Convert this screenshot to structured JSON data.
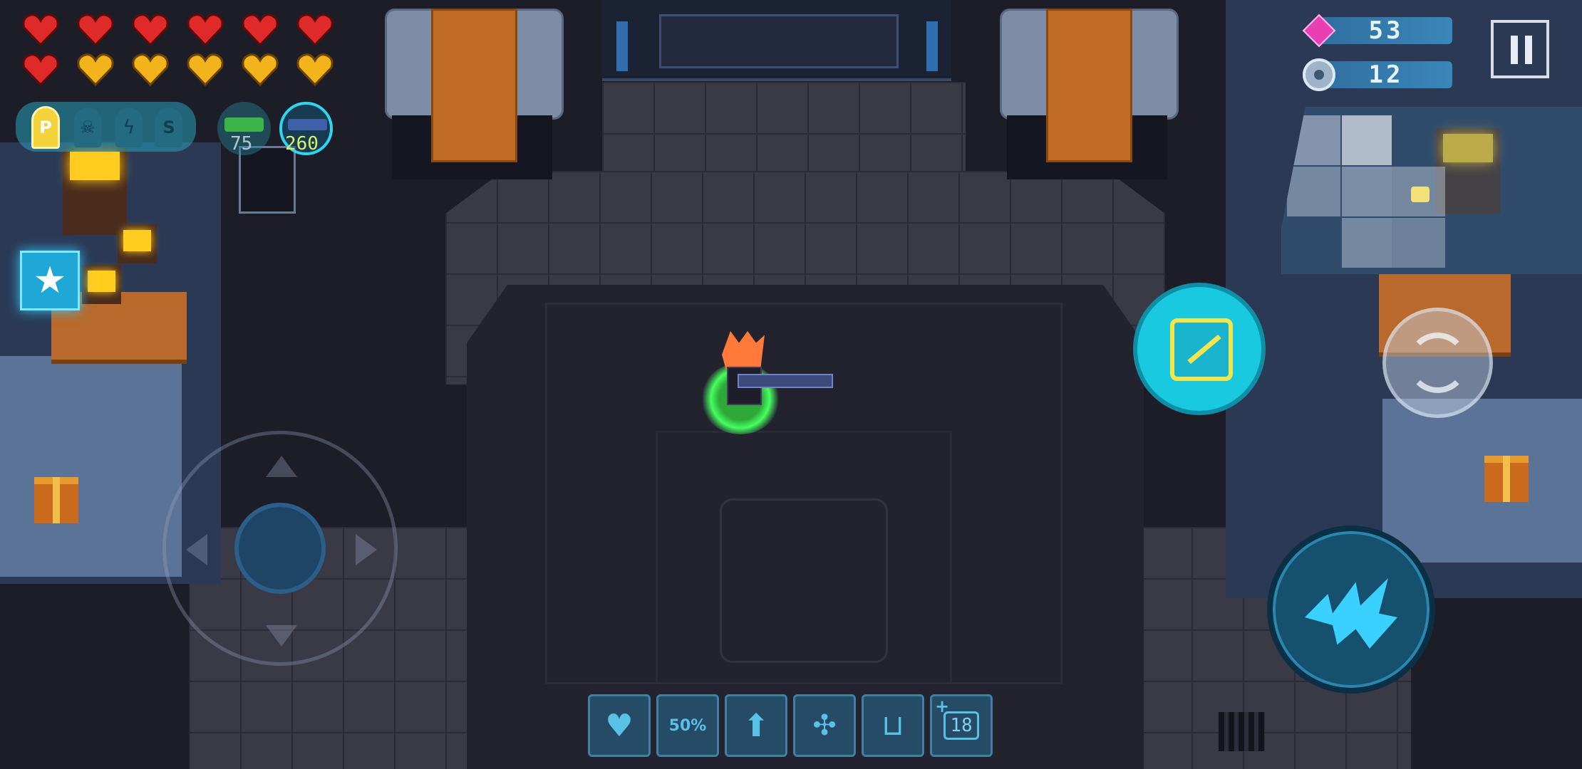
{
  "hud": {
    "health_hearts": {
      "red": 7,
      "gold": 5
    },
    "buff_slots": [
      {
        "label": "P",
        "icon": "bullet-p-icon",
        "active": true
      },
      {
        "label": "",
        "icon": "skull-icon",
        "active": false
      },
      {
        "label": "",
        "icon": "lightning-icon",
        "active": false
      },
      {
        "label": "S",
        "icon": "s-slot-icon",
        "active": false
      }
    ],
    "weapons": [
      {
        "icon": "green-gun-icon",
        "ammo": "75",
        "selected": false
      },
      {
        "icon": "sniper-rifle-icon",
        "ammo": "260",
        "selected": true
      }
    ],
    "gems": "53",
    "cores": "12",
    "pause_icon": "pause-icon",
    "star_icon": "star-badge-icon"
  },
  "controls": {
    "joystick": "virtual-joystick",
    "skill_button_icon": "dash-skill-icon",
    "swap_weapon_icon": "swap-weapon-icon",
    "attack_button_icon": "claw-attack-icon"
  },
  "skill_bar": [
    {
      "icon": "heart-burst-icon",
      "label": ""
    },
    {
      "icon": "percent-bag-icon",
      "label": "50%"
    },
    {
      "icon": "arrow-up-icon",
      "label": ""
    },
    {
      "icon": "network-icon",
      "label": ""
    },
    {
      "icon": "magnet-icon",
      "label": ""
    },
    {
      "icon": "chest-count-icon",
      "label": "18",
      "prefix": "+"
    }
  ],
  "colors": {
    "accent_cyan": "#19c9e0",
    "heart_red": "#e02a2a",
    "heart_gold": "#f2b31b",
    "gem_pink": "#e83fb2",
    "floor_light": "#3a3a47",
    "floor_dark": "#232330",
    "player_glow": "#33e04a"
  }
}
